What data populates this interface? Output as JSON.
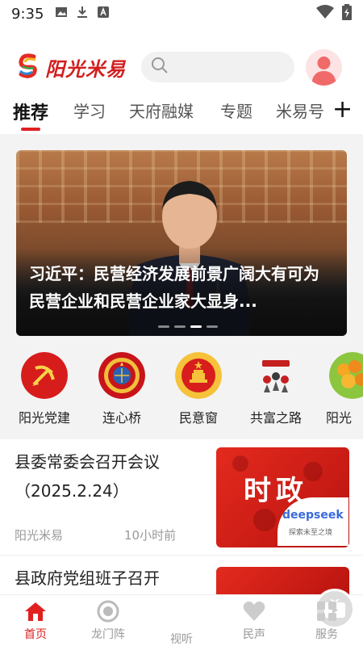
{
  "status_bar": {
    "time": "9:35"
  },
  "header": {
    "brand": "阳光米易",
    "search": {
      "placeholder": ""
    }
  },
  "tabs": [
    {
      "label": "推荐",
      "active": true
    },
    {
      "label": "学习"
    },
    {
      "label": "天府融媒"
    },
    {
      "label": "专题"
    },
    {
      "label": "米易号"
    }
  ],
  "banner": {
    "title": "习近平：民营经济发展前景广阔大有可为 民营企业和民营企业家大显身..."
  },
  "quick_links": [
    {
      "label": "阳光党建",
      "icon": "party-emblem-icon"
    },
    {
      "label": "连心桥",
      "icon": "cppcc-emblem-icon"
    },
    {
      "label": "民意窗",
      "icon": "national-emblem-icon"
    },
    {
      "label": "共富之路",
      "icon": "common-prosperity-icon"
    },
    {
      "label": "阳光",
      "icon": "fruit-icon"
    }
  ],
  "news": [
    {
      "title": "县委常委会召开会议（2025.2.24）",
      "source": "阳光米易",
      "time": "10小时前",
      "thumb_text": "时政",
      "thumb_badge": "deepseek",
      "thumb_badge_sub": "探索未至之境"
    },
    {
      "title": "县政府党组班子召开"
    }
  ],
  "bottom_nav": [
    {
      "label": "首页",
      "icon": "home-icon",
      "active": true
    },
    {
      "label": "龙门阵",
      "icon": "target-icon"
    },
    {
      "label": "视听",
      "icon": "tv-icon"
    },
    {
      "label": "民声",
      "icon": "heart-icon"
    },
    {
      "label": "服务",
      "icon": "grid-icon"
    }
  ],
  "colors": {
    "accent": "#e02020",
    "brand_red": "#d21f1f"
  }
}
